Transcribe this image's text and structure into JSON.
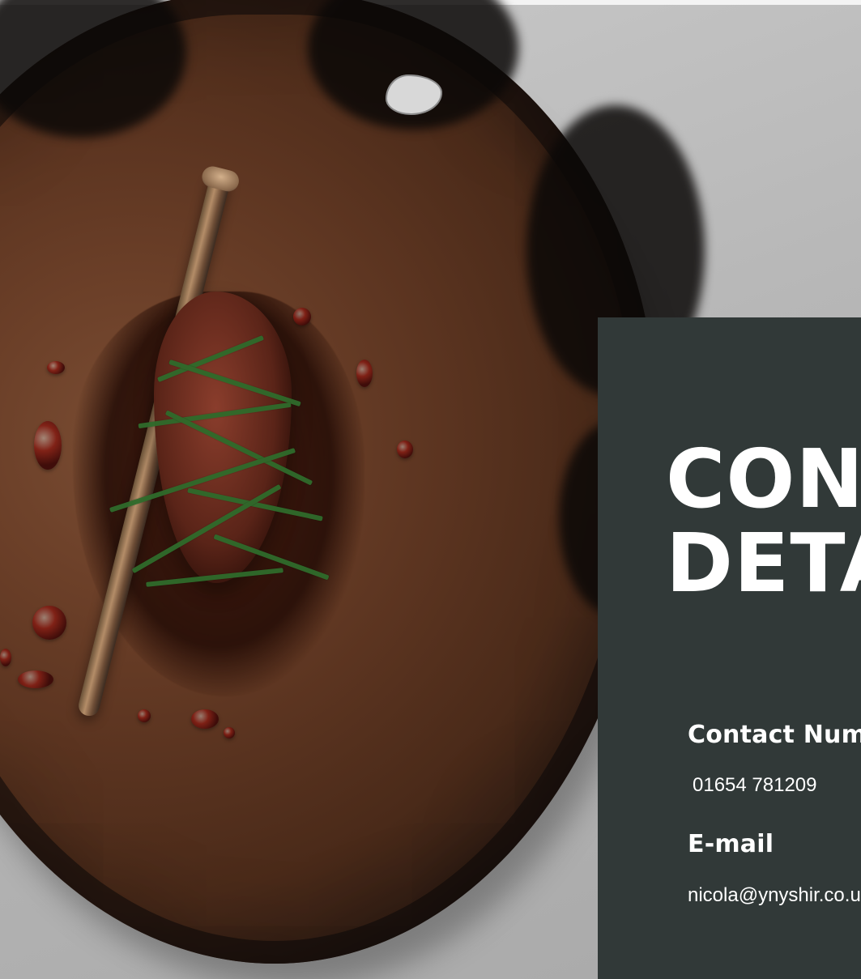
{
  "contact": {
    "heading_line_1": "CONT",
    "heading_line_2": "DETA",
    "phone_label": "Contact Number",
    "phone_value": "01654 781209",
    "email_label": "E-mail",
    "email_value": "nicola@ynyshir.co.uk"
  },
  "colors": {
    "panel_bg": "#313938",
    "text": "#ffffff",
    "background": "#b7b7b7",
    "wood": "#5b3420"
  }
}
